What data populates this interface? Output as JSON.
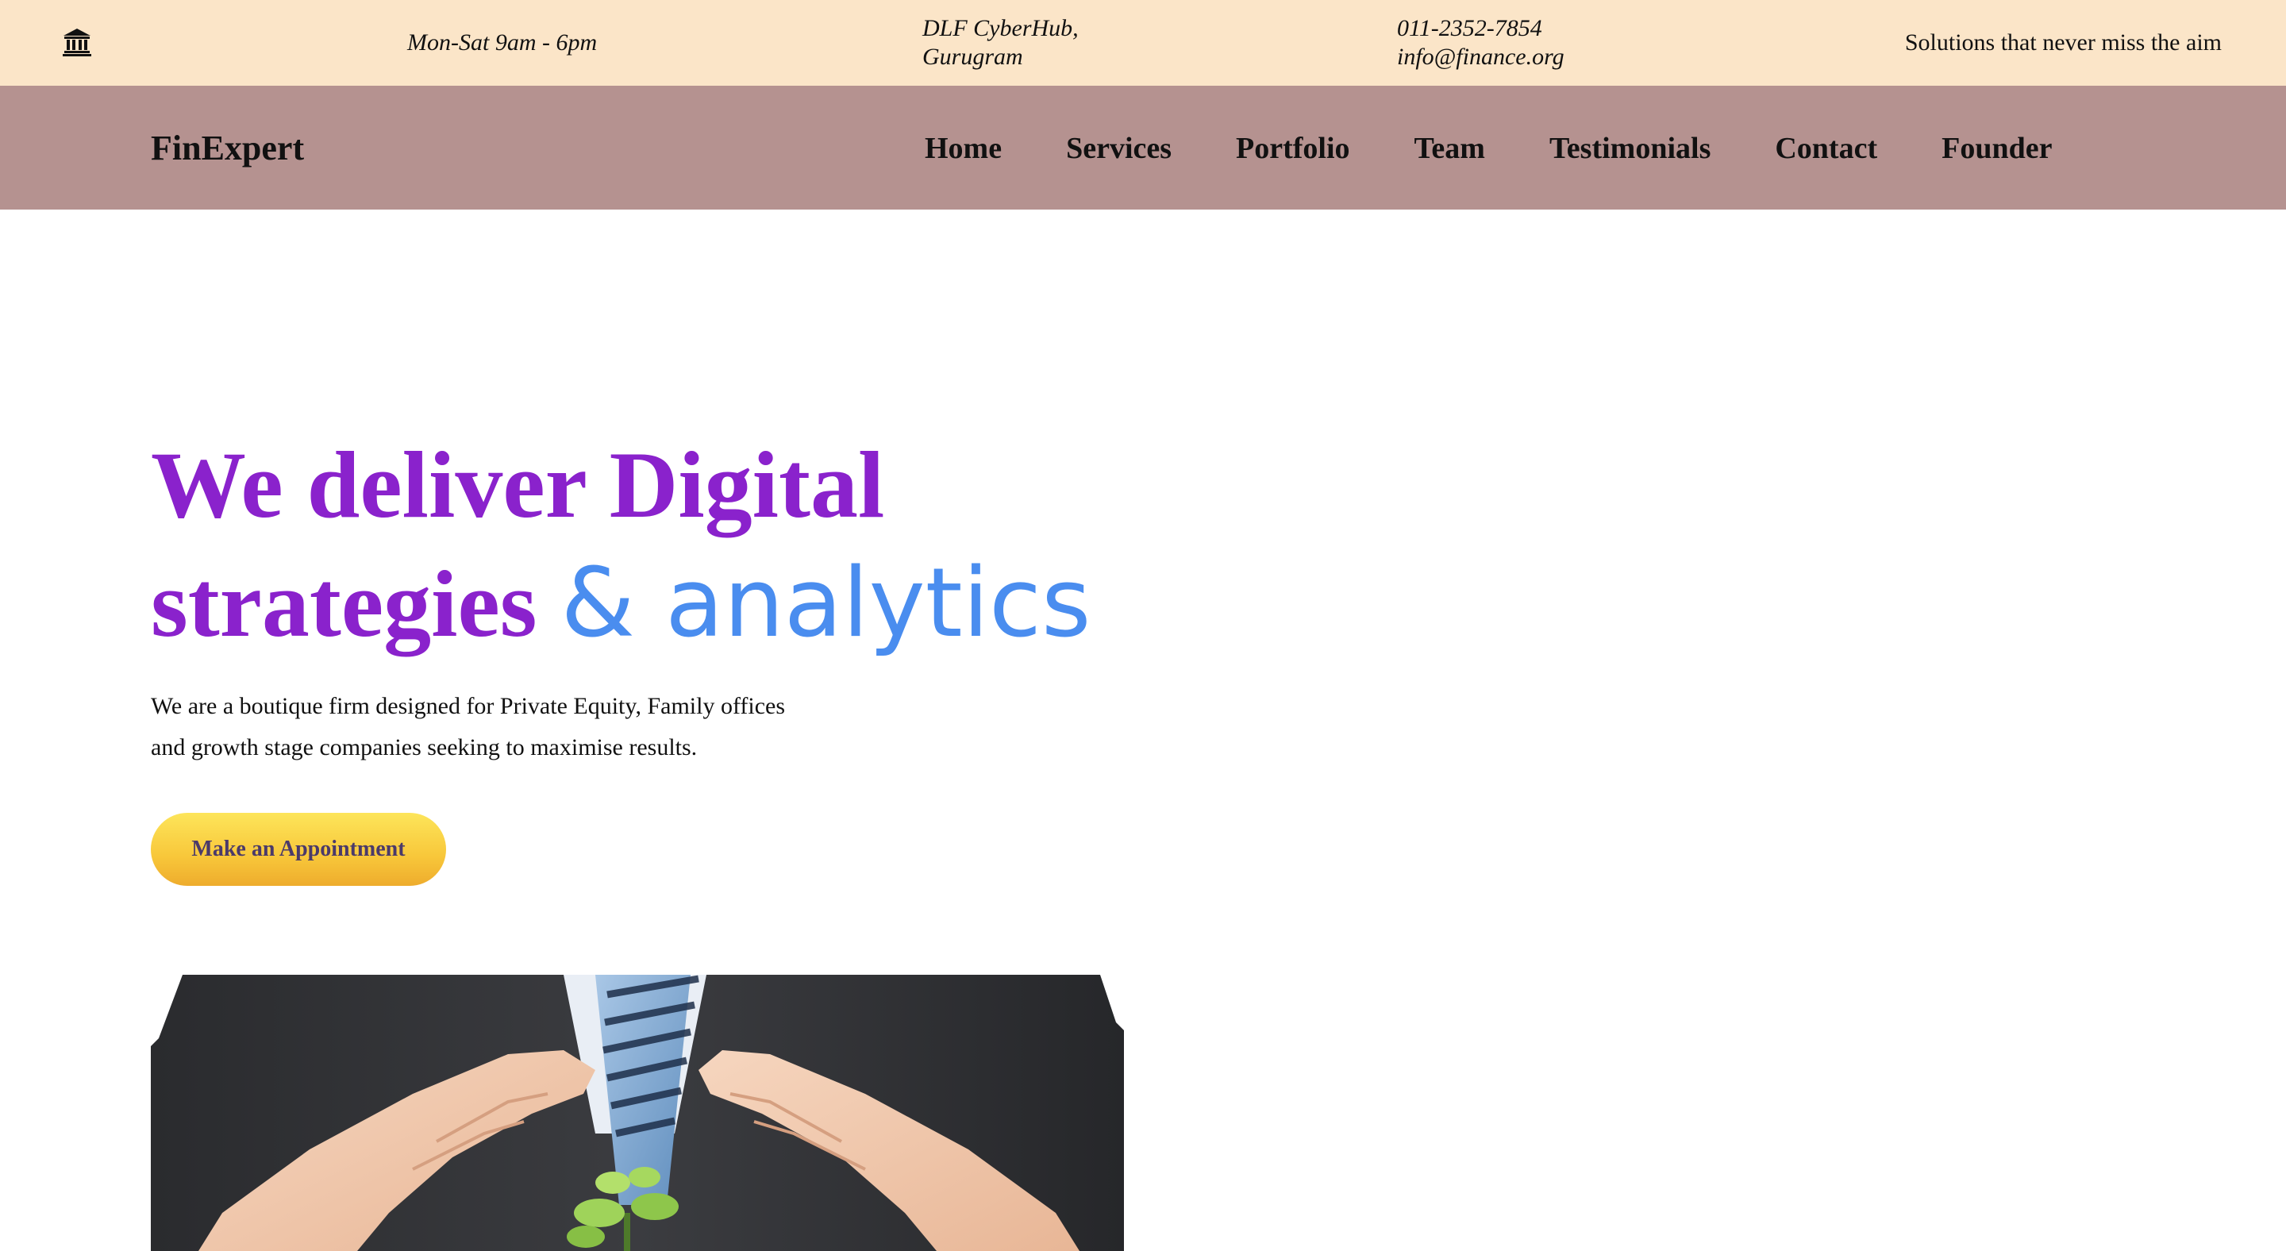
{
  "topbar": {
    "icon": "bank-icon",
    "hours": "Mon-Sat 9am - 6pm",
    "address_line1": "DLF CyberHub,",
    "address_line2": "Gurugram",
    "phone": "011-2352-7854",
    "email": "info@finance.org",
    "tagline": "Solutions that never miss the aim"
  },
  "nav": {
    "brand": "FinExpert",
    "items": [
      {
        "label": "Home"
      },
      {
        "label": "Services"
      },
      {
        "label": "Portfolio"
      },
      {
        "label": "Team"
      },
      {
        "label": "Testimonials"
      },
      {
        "label": "Contact"
      },
      {
        "label": "Founder"
      }
    ]
  },
  "hero": {
    "title_line1": "We deliver Digital",
    "title_line2_a": "strategies",
    "title_line2_b": "& analytics",
    "subtitle_line1": "We are a boutique firm designed for Private Equity, Family offices",
    "subtitle_line2": "and growth stage companies seeking to maximise results.",
    "cta_label": "Make an Appointment",
    "image_icon": "business-hands-sprout-image"
  },
  "colors": {
    "topbar_bg": "#fbe5c8",
    "navbar_bg": "#b59290",
    "title_purple": "#8a22cc",
    "title_blue": "#4a8def",
    "cta_yellow": "#f8c73a",
    "cta_text": "#4b3a6a"
  }
}
